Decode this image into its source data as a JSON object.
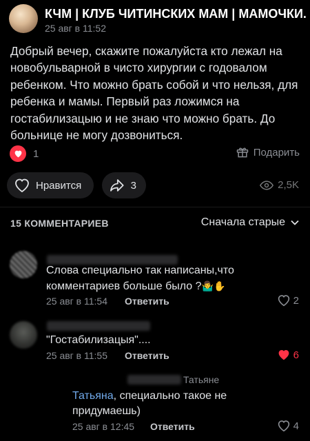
{
  "post": {
    "group_name": "КЧМ | КЛУБ ЧИТИНСКИХ МАМ | МАМОЧКИ...",
    "date": "25 авг в 11:52",
    "text": "Добрый вечер, скажите пожалуйста кто лежал на новобульварной в чисто хирургии с годовалом ребенком. Что можно брать собой и что нельзя, для ребенка и мамы. Первый раз ложимся на гостабилизацыю и не знаю что можно брать. До больнице не могу дозвониться.",
    "reactions_count": "1",
    "gift_label": "Подарить",
    "like_label": "Нравится",
    "share_count": "3",
    "views": "2,5K"
  },
  "comments_header": {
    "count_label": "15 КОММЕНТАРИЕВ",
    "sort_label": "Сначала старые"
  },
  "comments": [
    {
      "text": "Слова специально так написаны,что комментариев больше было ?",
      "emoji": "🤷‍♂️✋",
      "date": "25 авг в 11:54",
      "reply_label": "Ответить",
      "likes": "2",
      "liked": false
    },
    {
      "text": "\"Гостабилизацыя\"....",
      "date": "25 авг в 11:55",
      "reply_label": "Ответить",
      "likes": "6",
      "liked": true
    },
    {
      "author_visible": "Татьяне",
      "mention": "Татьяна",
      "text": ", специально такое не придумаешь)",
      "date": "25 авг в 12:45",
      "reply_label": "Ответить",
      "likes": "4",
      "liked": false
    }
  ],
  "colors": {
    "background": "#000000",
    "text": "#e1e3e6",
    "secondary": "#8b8e94",
    "accent_red": "#ff3347",
    "link": "#71aaeb",
    "pill": "#1c1c1e"
  }
}
